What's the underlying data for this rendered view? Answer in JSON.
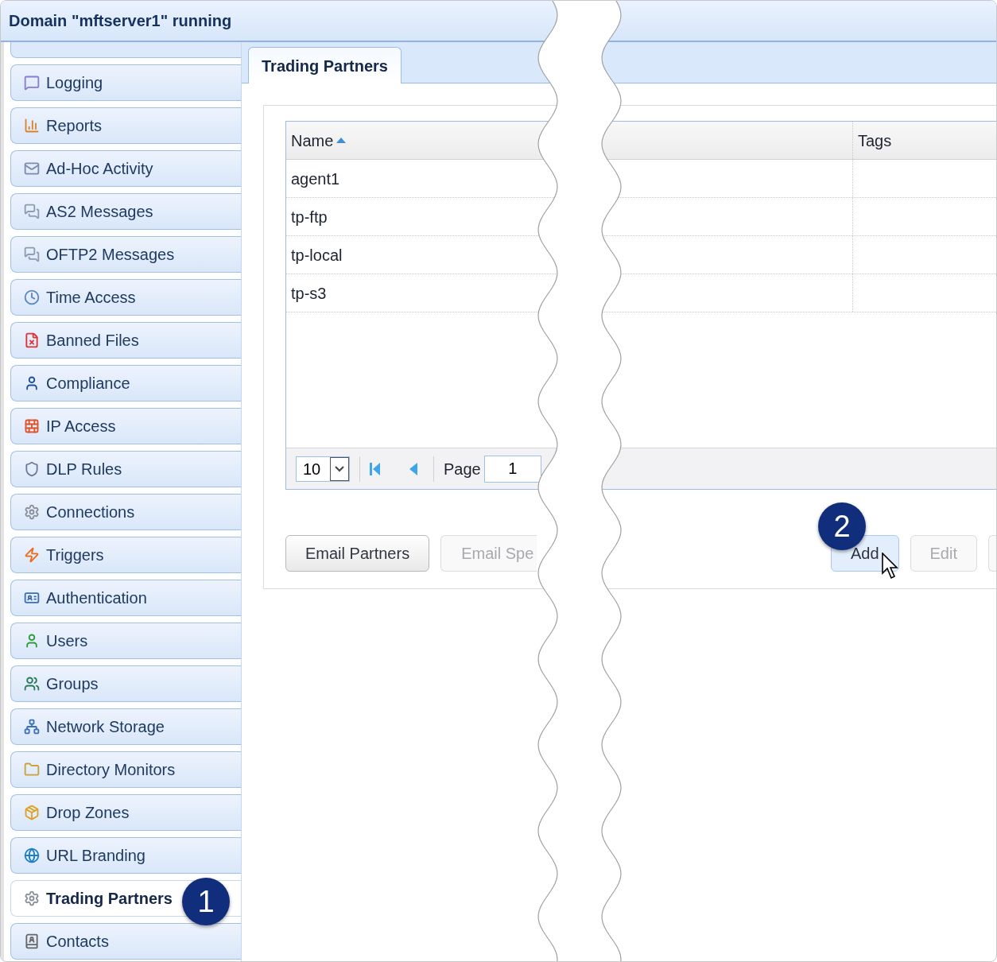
{
  "window": {
    "title": "Domain \"mftserver1\" running"
  },
  "sidebar": {
    "items": [
      {
        "label": "Logging",
        "selected": false
      },
      {
        "label": "Reports",
        "selected": false
      },
      {
        "label": "Ad-Hoc Activity",
        "selected": false
      },
      {
        "label": "AS2 Messages",
        "selected": false
      },
      {
        "label": "OFTP2 Messages",
        "selected": false
      },
      {
        "label": "Time Access",
        "selected": false
      },
      {
        "label": "Banned Files",
        "selected": false
      },
      {
        "label": "Compliance",
        "selected": false
      },
      {
        "label": "IP Access",
        "selected": false
      },
      {
        "label": "DLP Rules",
        "selected": false
      },
      {
        "label": "Connections",
        "selected": false
      },
      {
        "label": "Triggers",
        "selected": false
      },
      {
        "label": "Authentication",
        "selected": false
      },
      {
        "label": "Users",
        "selected": false
      },
      {
        "label": "Groups",
        "selected": false
      },
      {
        "label": "Network Storage",
        "selected": false
      },
      {
        "label": "Directory Monitors",
        "selected": false
      },
      {
        "label": "Drop Zones",
        "selected": false
      },
      {
        "label": "URL Branding",
        "selected": false
      },
      {
        "label": "Trading Partners",
        "selected": true
      },
      {
        "label": "Contacts",
        "selected": false
      }
    ]
  },
  "tabs": [
    {
      "label": "Trading Partners",
      "selected": true
    }
  ],
  "table": {
    "columns": [
      {
        "label": "Name",
        "sorted": true
      },
      {
        "label": "Tags",
        "sorted": false
      }
    ],
    "rows": [
      {
        "name": "agent1"
      },
      {
        "name": "tp-ftp"
      },
      {
        "name": "tp-local"
      },
      {
        "name": "tp-s3"
      }
    ]
  },
  "pager": {
    "page_size": "10",
    "page_label": "Page",
    "page": "1"
  },
  "left_buttons": [
    {
      "label": "Email Partners",
      "disabled": false,
      "hovered": false
    },
    {
      "label": "Email Spe",
      "disabled": true,
      "hovered": false
    }
  ],
  "right_buttons": [
    {
      "label": "Add",
      "disabled": false,
      "hovered": true
    },
    {
      "label": "Edit",
      "disabled": true,
      "hovered": false
    }
  ],
  "callouts": [
    {
      "number": "1"
    },
    {
      "number": "2"
    }
  ]
}
